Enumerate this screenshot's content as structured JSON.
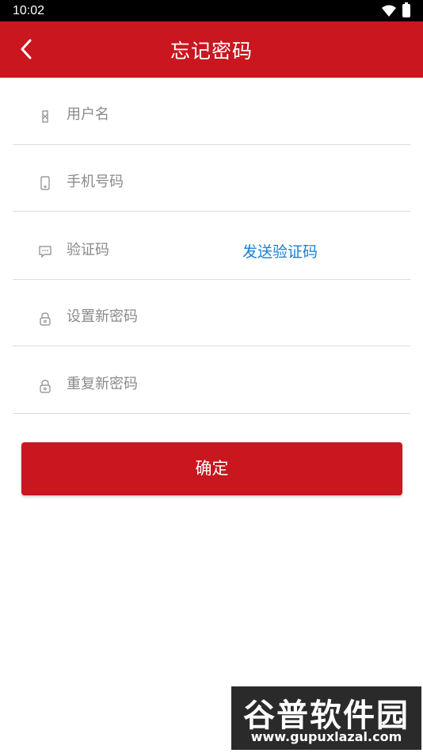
{
  "status_bar": {
    "time": "10:02"
  },
  "header": {
    "title": "忘记密码"
  },
  "form": {
    "username": {
      "placeholder": "用户名"
    },
    "phone": {
      "placeholder": "手机号码"
    },
    "code": {
      "placeholder": "验证码",
      "send_label": "发送验证码"
    },
    "new_password": {
      "placeholder": "设置新密码"
    },
    "repeat_password": {
      "placeholder": "重复新密码"
    }
  },
  "confirm_label": "确定",
  "watermark": {
    "title": "谷普软件园",
    "url": "www.gupuxlazal.com"
  },
  "colors": {
    "primary": "#c9161f",
    "link": "#1a7fd4"
  }
}
